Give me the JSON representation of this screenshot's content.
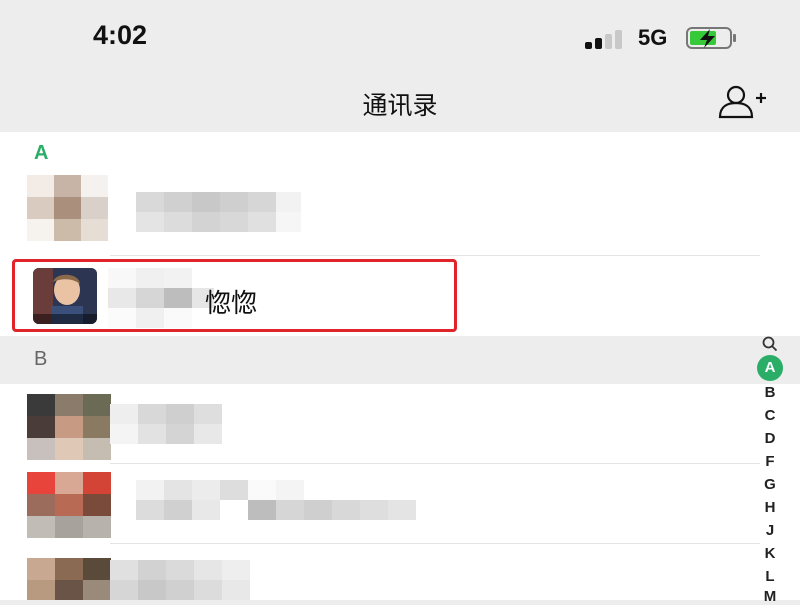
{
  "status_bar": {
    "time": "4:02",
    "network": "5G",
    "battery_charging": true,
    "signal_bars_filled": 2,
    "signal_bars_total": 4
  },
  "nav": {
    "title": "通讯录",
    "add_contact_icon": "add-contact-icon"
  },
  "sections": [
    {
      "letter": "A",
      "color": "#2aae67"
    },
    {
      "letter": "B",
      "color": "#666666"
    }
  ],
  "contacts": {
    "highlighted_name_visible": "惚惚"
  },
  "index_bar": {
    "search_icon": "search-icon",
    "active": "A",
    "letters": [
      "B",
      "C",
      "D",
      "F",
      "G",
      "H",
      "J",
      "K",
      "L",
      "M"
    ]
  },
  "colors": {
    "accent": "#2aae67",
    "highlight": "#e0242a",
    "background": "#ededed"
  }
}
